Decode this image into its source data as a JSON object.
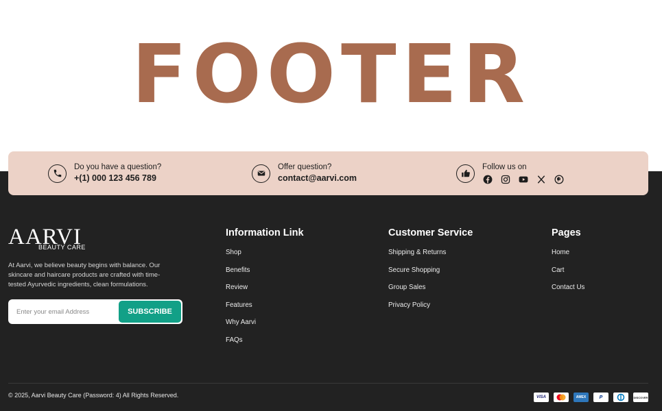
{
  "hero": {
    "title": "FOOTER"
  },
  "contact_bar": {
    "phone": {
      "label": "Do you have a question?",
      "value": "+(1) 000 123 456 789",
      "icon": "phone-icon"
    },
    "email": {
      "label": "Offer question?",
      "value": "contact@aarvi.com",
      "icon": "envelope-icon"
    },
    "social": {
      "label": "Follow us on",
      "icon": "thumbs-up-icon",
      "items": [
        "facebook-icon",
        "instagram-icon",
        "youtube-icon",
        "x-icon",
        "pinterest-icon"
      ]
    }
  },
  "brand": {
    "logo_main": "AARVI",
    "logo_sub": "BEAUTY CARE",
    "about": "At Aarvi, we believe beauty begins with balance. Our skincare and haircare products are crafted with time-tested Ayurvedic ingredients, clean formulations.",
    "email_placeholder": "Enter your email Address",
    "subscribe_label": "SUBSCRIBE"
  },
  "columns": [
    {
      "title": "Information Link",
      "links": [
        "Shop",
        "Benefits",
        "Review",
        "Features",
        "Why Aarvi",
        "FAQs"
      ]
    },
    {
      "title": "Customer Service",
      "links": [
        "Shipping & Returns",
        "Secure Shopping",
        "Group Sales",
        "Privacy Policy"
      ]
    },
    {
      "title": "Pages",
      "links": [
        "Home",
        "Cart",
        "Contact Us"
      ]
    }
  ],
  "copyright": "© 2025, Aarvi Beauty Care (Password: 4) All Rights Reserved.",
  "payments": [
    {
      "name": "visa-icon",
      "text": "VISA"
    },
    {
      "name": "mastercard-icon",
      "text": ""
    },
    {
      "name": "amex-icon",
      "text": "AMEX"
    },
    {
      "name": "paypal-icon",
      "text": "P"
    },
    {
      "name": "diners-club-icon",
      "text": ""
    },
    {
      "name": "discover-icon",
      "text": "DISCOVER"
    }
  ],
  "colors": {
    "hero_title": "#a86b4f",
    "contact_bar_bg": "#ecd2c7",
    "footer_bg": "#222222",
    "subscribe_btn": "#12a087"
  }
}
